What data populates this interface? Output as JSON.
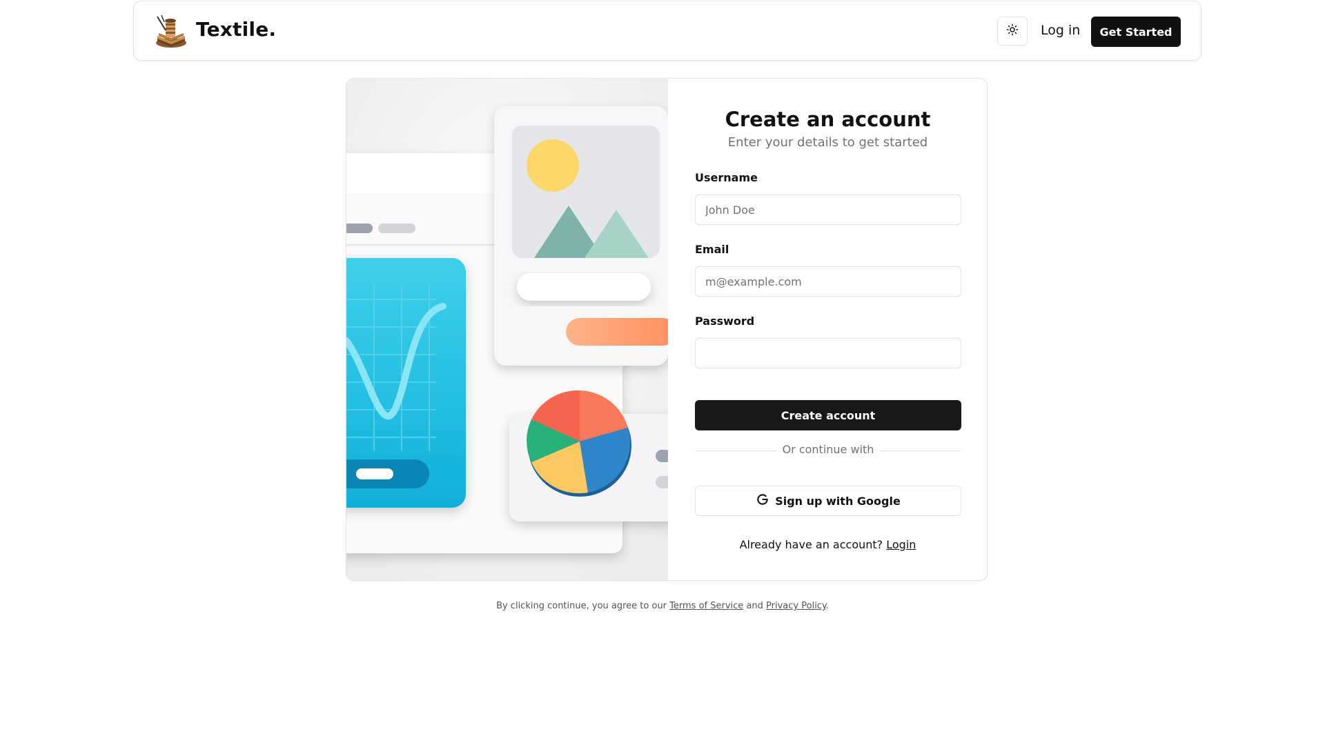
{
  "header": {
    "brand": "Textile.",
    "login_label": "Log in",
    "get_started_label": "Get Started"
  },
  "form": {
    "title": "Create an account",
    "subtitle": "Enter your details to get started",
    "username_label": "Username",
    "username_placeholder": "John Doe",
    "username_value": "",
    "email_label": "Email",
    "email_placeholder": "m@example.com",
    "email_value": "",
    "password_label": "Password",
    "password_value": "",
    "submit_label": "Create account",
    "divider_text": "Or continue with",
    "google_label": "Sign up with Google",
    "have_account_text": "Already have an account?",
    "login_link": "Login"
  },
  "footer": {
    "prefix": "By clicking continue, you agree to our",
    "terms": "Terms of Service",
    "and": "and",
    "privacy": "Privacy Policy",
    "suffix": "."
  },
  "colors": {
    "primary": "#18181b",
    "border": "#e4e4e7",
    "muted": "#71717a"
  },
  "icons": {
    "logo": "thread-spool-logo",
    "theme": "sun-icon",
    "google": "google-g-icon"
  }
}
